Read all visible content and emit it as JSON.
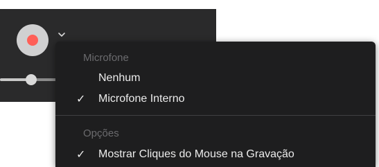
{
  "colors": {
    "record_dot": "#ff5f57",
    "panel_background": "#2a2a2b",
    "menu_background": "#1e1e1f",
    "menu_text": "#ececec",
    "menu_header_text": "#6b6b6e"
  },
  "recorder": {
    "record_icon": "record-icon",
    "chevron_icon": "chevron-down-icon",
    "volume_level": 0.5
  },
  "menu": {
    "microphone_header": "Microfone",
    "microphone_items": [
      {
        "label": "Nenhum",
        "checked": false
      },
      {
        "label": "Microfone Interno",
        "checked": true
      }
    ],
    "options_header": "Opções",
    "options_items": [
      {
        "label": "Mostrar Cliques do Mouse na Gravação",
        "checked": true
      }
    ],
    "check_mark": "✓"
  }
}
